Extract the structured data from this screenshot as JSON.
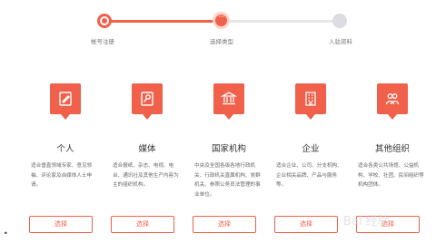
{
  "stepper": {
    "steps": [
      {
        "label": "帐号注册",
        "state": "done"
      },
      {
        "label": "选择类型",
        "state": "current"
      },
      {
        "label": "入驻资料",
        "state": "todo"
      }
    ]
  },
  "accent_color": "#f0604a",
  "cards": [
    {
      "icon": "pencil-icon",
      "title": "个人",
      "description": "适合垂直领域专家、意见领袖、评论家及自媒体人士申请。",
      "button": "选择"
    },
    {
      "icon": "microphone-icon",
      "title": "媒体",
      "description": "适合报纸、杂志、电视、电台、通讯社及其他生产内容为主的组织机构。",
      "button": "选择"
    },
    {
      "icon": "institution-building-icon",
      "title": "国家机构",
      "description": "中央及全国各级各地行政机关、行政机关直属机构、党群机关、参照公务员法管理的事业单位。",
      "button": "选择"
    },
    {
      "icon": "enterprise-building-icon",
      "title": "企业",
      "description": "适合企业、公司、分支机构、企业相关品牌、产品与服务等。",
      "button": "选择"
    },
    {
      "icon": "people-icon",
      "title": "其他组织",
      "description": "适合各类公共场馆、公益机构、学校、社团、民间组织等机构团体。",
      "button": "选择"
    }
  ],
  "bullet": "•",
  "watermark": "Bai 经验"
}
